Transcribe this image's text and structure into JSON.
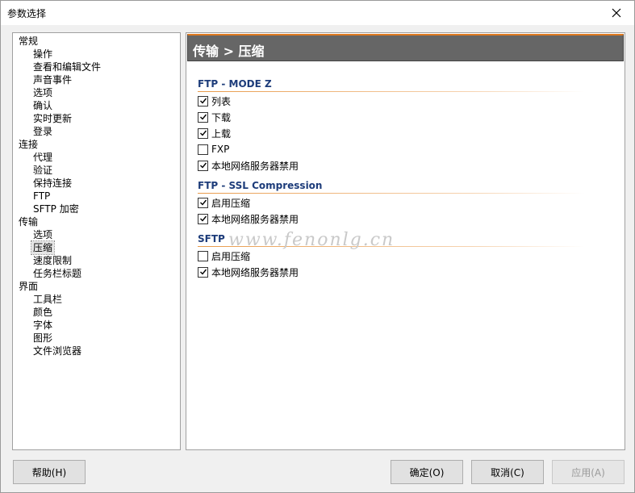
{
  "window": {
    "title": "参数选择"
  },
  "tree": {
    "items": [
      {
        "label": "常规",
        "level": 0
      },
      {
        "label": "操作",
        "level": 1
      },
      {
        "label": "查看和编辑文件",
        "level": 1
      },
      {
        "label": "声音事件",
        "level": 1
      },
      {
        "label": "选项",
        "level": 1
      },
      {
        "label": "确认",
        "level": 1
      },
      {
        "label": "实时更新",
        "level": 1
      },
      {
        "label": "登录",
        "level": 1
      },
      {
        "label": "连接",
        "level": 0
      },
      {
        "label": "代理",
        "level": 1
      },
      {
        "label": "验证",
        "level": 1
      },
      {
        "label": "保持连接",
        "level": 1
      },
      {
        "label": "FTP",
        "level": 1
      },
      {
        "label": "SFTP 加密",
        "level": 1
      },
      {
        "label": "传输",
        "level": 0
      },
      {
        "label": "选项",
        "level": 1
      },
      {
        "label": "压缩",
        "level": 1,
        "selected": true
      },
      {
        "label": "速度限制",
        "level": 1
      },
      {
        "label": "任务栏标题",
        "level": 1
      },
      {
        "label": "界面",
        "level": 0
      },
      {
        "label": "工具栏",
        "level": 1
      },
      {
        "label": "颜色",
        "level": 1
      },
      {
        "label": "字体",
        "level": 1
      },
      {
        "label": "图形",
        "level": 1
      },
      {
        "label": "文件浏览器",
        "level": 1
      }
    ]
  },
  "content": {
    "header": "传输 > 压缩",
    "sections": [
      {
        "title": "FTP - MODE Z",
        "options": [
          {
            "label": "列表",
            "checked": true
          },
          {
            "label": "下载",
            "checked": true
          },
          {
            "label": "上载",
            "checked": true
          },
          {
            "label": "FXP",
            "checked": false
          },
          {
            "label": "本地网络服务器禁用",
            "checked": true
          }
        ]
      },
      {
        "title": "FTP - SSL Compression",
        "options": [
          {
            "label": "启用压缩",
            "checked": true
          },
          {
            "label": "本地网络服务器禁用",
            "checked": true
          }
        ]
      },
      {
        "title": "SFTP",
        "options": [
          {
            "label": "启用压缩",
            "checked": false
          },
          {
            "label": "本地网络服务器禁用",
            "checked": true
          }
        ]
      }
    ],
    "watermark": "www.fenonlg.cn"
  },
  "buttons": {
    "help": "帮助(H)",
    "ok": "确定(O)",
    "cancel": "取消(C)",
    "apply": "应用(A)"
  }
}
